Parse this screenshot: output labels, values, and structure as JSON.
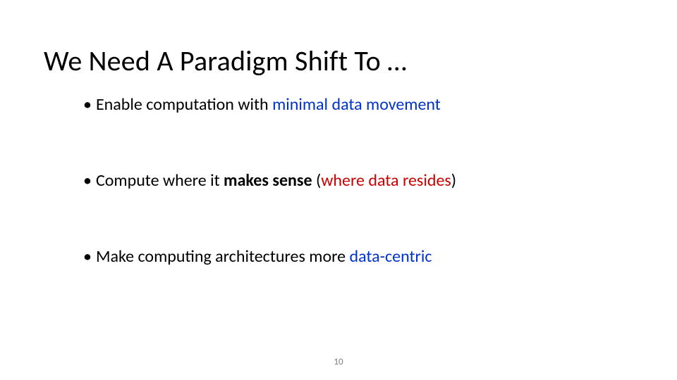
{
  "title": "We Need A Paradigm Shift To …",
  "bullets": {
    "b1": {
      "t1": "Enable computation with ",
      "t2": "minimal data movement"
    },
    "b2": {
      "t1": "Compute where it ",
      "bold1": "makes sense",
      "t2": " (",
      "hl": "where data resides",
      "t3": ")"
    },
    "b3": {
      "t1": "Make computing architectures more ",
      "t2": "data-centric"
    }
  },
  "page_number": "10"
}
